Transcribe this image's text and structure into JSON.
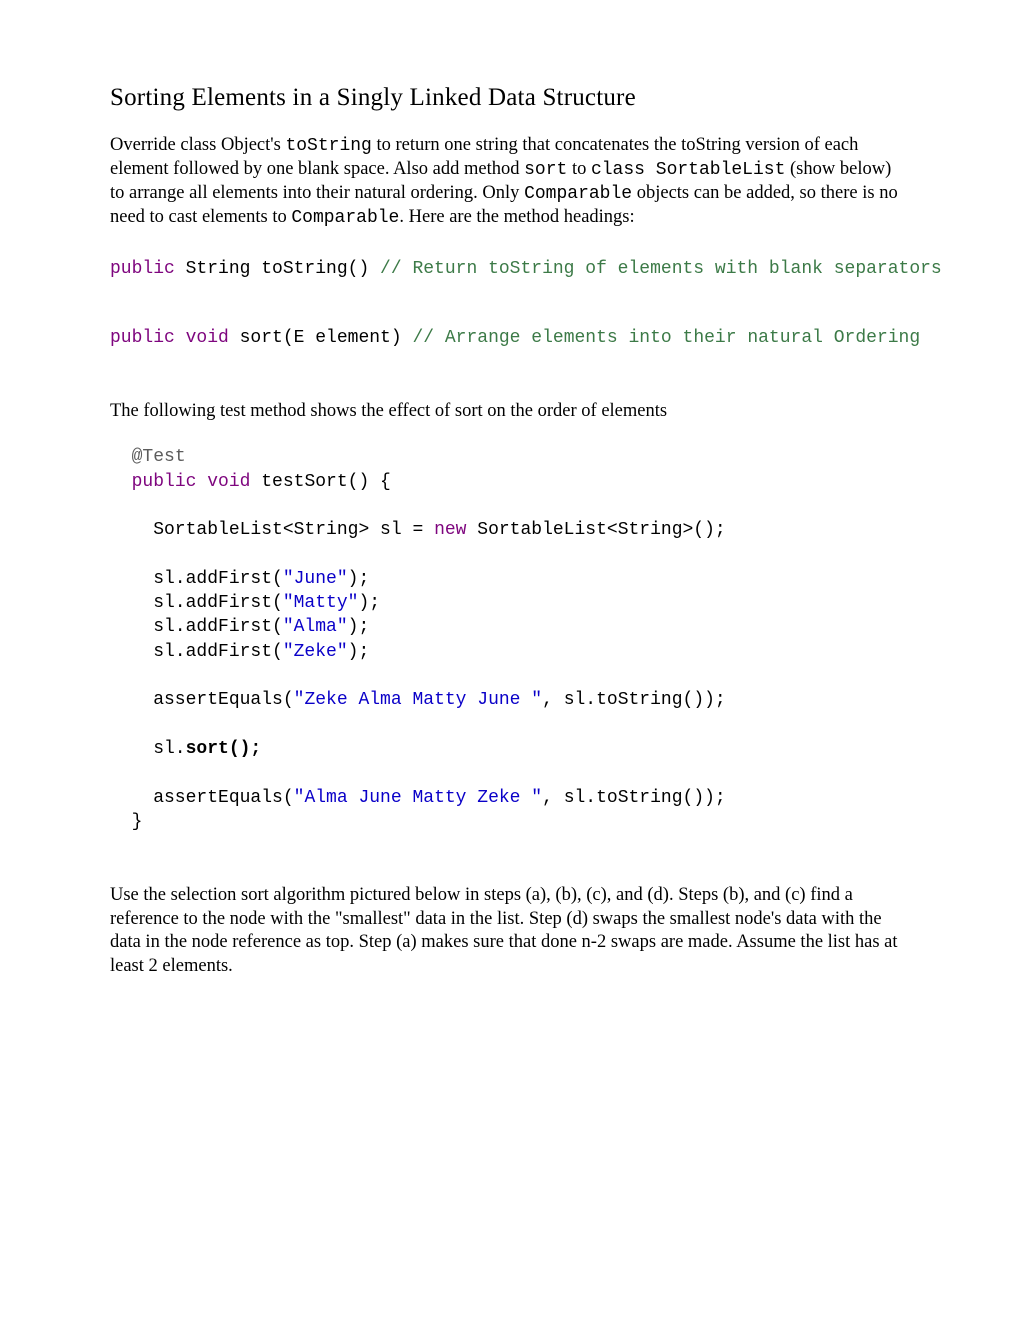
{
  "title": "Sorting Elements in a Singly Linked Data Structure",
  "para1_a": "Override class Object's ",
  "para1_b": " to return one string that concatenates the toString version of each element followed by one blank space.  Also add method ",
  "para1_c": " to ",
  "para1_d": " (show below) to arrange all elements into their natural ordering. Only ",
  "para1_e": " objects can be added, so there is no need to cast elements to ",
  "para1_f": ". Here are the method headings:",
  "m_toString": "toString",
  "m_sort": "sort",
  "m_class": "class SortableList",
  "m_Comparable": "Comparable",
  "m_Comparable2": "Comparable",
  "sig1_kw": "public",
  "sig1_rest": " String toString() ",
  "sig1_com": "// Return toString of elements with blank separators",
  "sig2_kw": "public void",
  "sig2_rest": " sort(E element) ",
  "sig2_com": "// Arrange elements into their natural Ordering",
  "para2": "The following test method shows the effect of sort on the order of elements",
  "c_ann": "@Test",
  "c_kw_pv": "public void",
  "c_m": " testSort() {",
  "c_l1a": "    SortableList<String> sl = ",
  "c_l1_kwnew": "new",
  "c_l1b": " SortableList<String>();",
  "c_l2": "    sl.addFirst(",
  "c_s_june": "\"June\"",
  "c_l3": "    sl.addFirst(",
  "c_s_matty": "\"Matty\"",
  "c_l4": "    sl.addFirst(",
  "c_s_alma": "\"Alma\"",
  "c_l5": "    sl.addFirst(",
  "c_s_zeke": "\"Zeke\"",
  "c_l6": "    assertEquals(",
  "c_s_before": "\"Zeke Alma Matty June \"",
  "c_l6b": ", sl.toString());",
  "c_l7a": "    sl.",
  "c_l7b": "sort();",
  "c_l8": "    assertEquals(",
  "c_s_after": "\"Alma June Matty Zeke \"",
  "c_l8b": ", sl.toString());",
  "c_close": "  }",
  "c_paren": ");",
  "para3": "Use the selection sort algorithm pictured below in steps (a), (b), (c), and (d). Steps (b), and (c) find a reference to the node with the \"smallest\" data in the list. Step (d) swaps the smallest node's data with the data in the node reference as top. Step (a) makes sure that done n-2 swaps are made. Assume the list has at least 2 elements.",
  "indent": "  "
}
